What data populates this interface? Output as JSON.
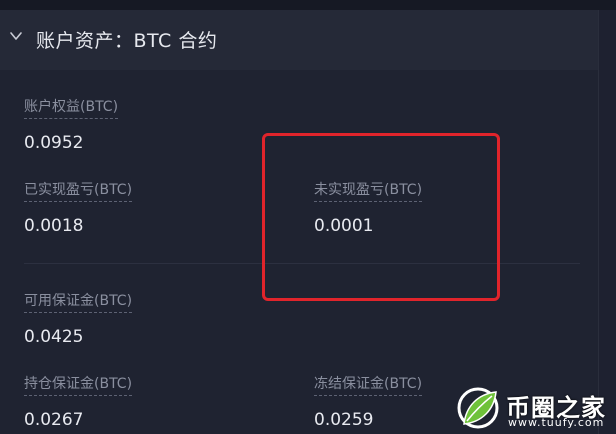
{
  "header": {
    "title": "账户资产：BTC 合约"
  },
  "fields": {
    "account_equity": {
      "label": "账户权益(BTC)",
      "value": "0.0952"
    },
    "realized_pnl": {
      "label": "已实现盈亏(BTC)",
      "value": "0.0018"
    },
    "unrealized_pnl": {
      "label": "未实现盈亏(BTC)",
      "value": "0.0001"
    },
    "available_margin": {
      "label": "可用保证金(BTC)",
      "value": "0.0425"
    },
    "position_margin": {
      "label": "持仓保证金(BTC)",
      "value": "0.0267"
    },
    "frozen_margin": {
      "label": "冻结保证金(BTC)",
      "value": "0.0259"
    }
  },
  "watermark": {
    "name": "币圈之家",
    "site": "www.tuufy.com"
  },
  "colors": {
    "background": "#1f2331",
    "header": "#252937",
    "label": "#8a8f9f",
    "value": "#e8eaf0",
    "highlight": "#e0242b",
    "logo_green": "#6fc23a"
  },
  "icons": {
    "collapse": "chevron-down-icon",
    "logo": "leaf-logo-icon"
  }
}
